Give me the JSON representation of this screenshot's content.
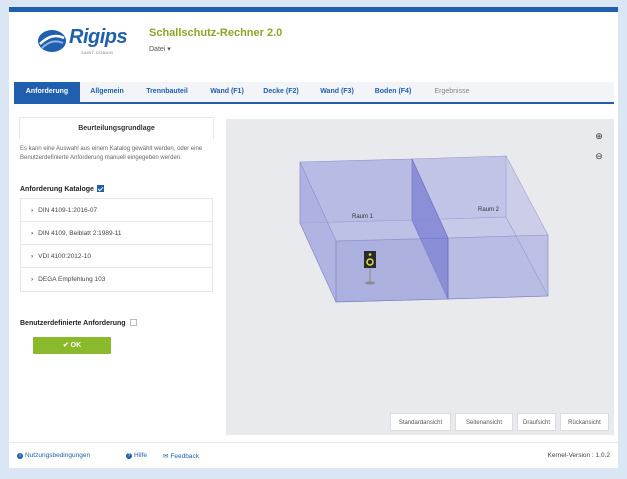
{
  "header": {
    "brand": "Rigips",
    "brand_sub": "SAINT-GOBAIN",
    "title": "Schallschutz-Rechner 2.0",
    "menu_label": "Datei ▾"
  },
  "tabs": [
    {
      "label": "Anforderung",
      "state": "active"
    },
    {
      "label": "Allgemein",
      "state": "normal"
    },
    {
      "label": "Trennbauteil",
      "state": "normal"
    },
    {
      "label": "Wand (F1)",
      "state": "normal"
    },
    {
      "label": "Decke (F2)",
      "state": "normal"
    },
    {
      "label": "Wand (F3)",
      "state": "normal"
    },
    {
      "label": "Boden (F4)",
      "state": "normal"
    },
    {
      "label": "Ergebnisse",
      "state": "disabled"
    }
  ],
  "left_panel": {
    "title": "Beurteilungsgrundlage",
    "description": "Es kann eine Auswahl aus einem Katalog gewählt werden, oder eine Benutzerdefinierte Anforderung manuell eingegeben werden.",
    "catalog_label": "Anforderung Kataloge",
    "catalog_checked": true,
    "catalogs": [
      "DIN 4109-1:2016-07",
      "DIN 4109, Beiblatt 2:1989-11",
      "VDI 4100:2012-10",
      "DEGA Empfehlung 103"
    ],
    "custom_label": "Benutzerdefinierte Anforderung",
    "custom_checked": false,
    "ok_label": "✔ OK"
  },
  "view3d": {
    "room1_label": "Raum 1",
    "room2_label": "Raum 2",
    "zoom_in_icon": "⊕",
    "zoom_out_icon": "⊖",
    "view_buttons": [
      "Standardansicht",
      "Seitenansicht",
      "Draufsicht",
      "Rückansicht"
    ]
  },
  "footer": {
    "terms": "Nutzungsbedingungen",
    "help": "Hilfe",
    "feedback": "Feedback",
    "version": "Kernel-Version : 1.0.2"
  },
  "colors": {
    "brand_blue": "#1f5fae",
    "title_green": "#8aa528",
    "ok_green": "#8aba2c",
    "room_fill": "#8a8fd8"
  }
}
